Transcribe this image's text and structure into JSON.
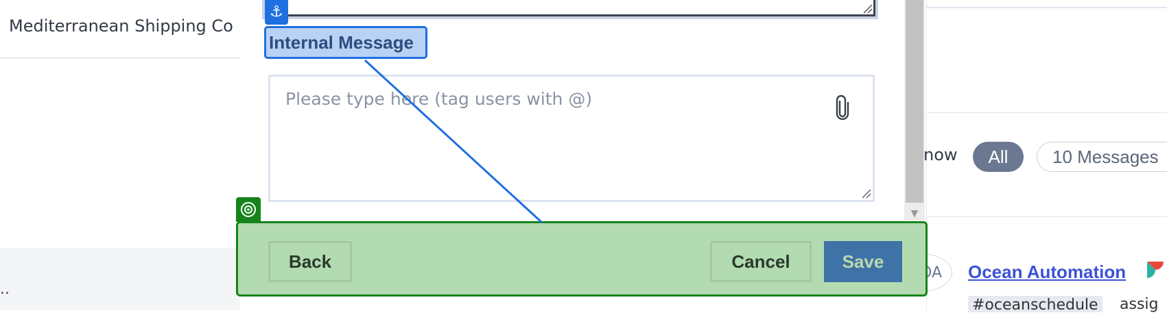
{
  "background": {
    "left_header_text": "Mediterranean Shipping Co",
    "ellipsis": "..",
    "right_panel": {
      "show_label": "now",
      "filter_all": "All",
      "filter_messages": "10 Messages",
      "avatar_initials": "OA",
      "sender_link": "Ocean Automation",
      "tag_chip": "#oceanschedule",
      "tag_rest": "assig"
    }
  },
  "modal": {
    "anchor_icon": "anchor-icon",
    "internal_label": "Internal Message",
    "message_placeholder": "Please type here (tag users with @)",
    "attach_icon": "paperclip-icon",
    "footer": {
      "target_icon": "target-icon",
      "back_label": "Back",
      "cancel_label": "Cancel",
      "save_label": "Save"
    }
  },
  "colors": {
    "highlight_blue": "#1f6fe0",
    "overlay_green": "#16841a",
    "save_button": "#3f72a6",
    "pill_active": "#6b7891"
  }
}
